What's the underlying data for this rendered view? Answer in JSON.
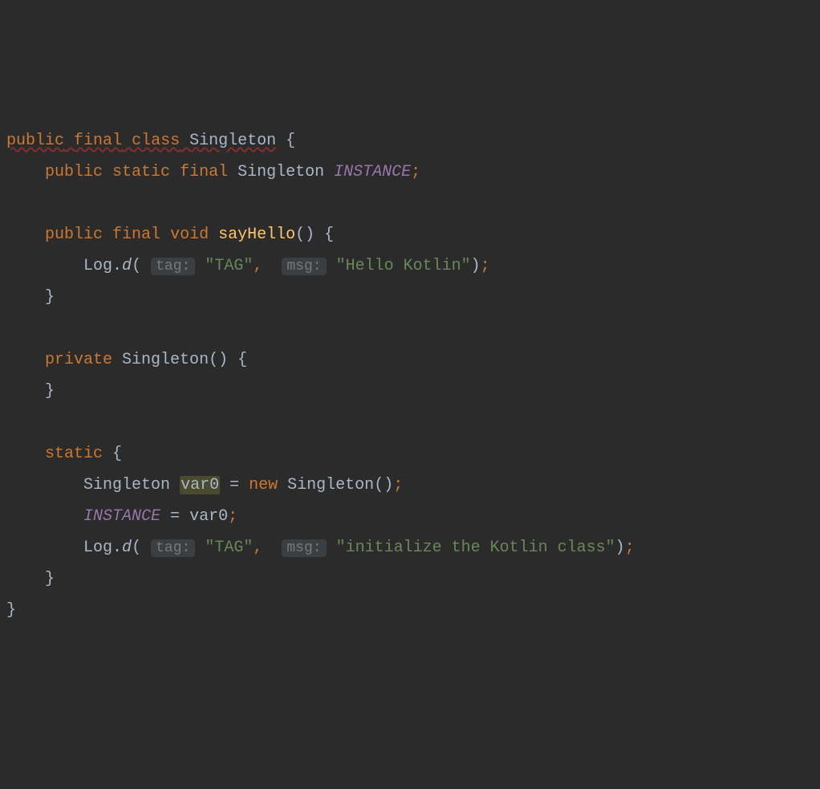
{
  "code": {
    "line1": {
      "kw_public": "public",
      "kw_final": "final",
      "kw_class": "class",
      "class_name": "Singleton",
      "brace_open": "{"
    },
    "line2": {
      "kw_public": "public",
      "kw_static": "static",
      "kw_final": "final",
      "type": "Singleton",
      "field": "INSTANCE",
      "semi": ";"
    },
    "line4": {
      "kw_public": "public",
      "kw_final": "final",
      "kw_void": "void",
      "method": "sayHello",
      "parens": "()",
      "brace_open": "{"
    },
    "line5": {
      "call_class": "Log",
      "dot": ".",
      "call_method": "d",
      "paren_open": "(",
      "hint_tag": "tag:",
      "str_tag": "\"TAG\"",
      "comma": ",",
      "hint_msg": "msg:",
      "str_msg": "\"Hello Kotlin\"",
      "paren_close": ")",
      "semi": ";"
    },
    "line6": {
      "brace_close": "}"
    },
    "line8": {
      "kw_private": "private",
      "ctor": "Singleton",
      "parens": "()",
      "brace_open": "{"
    },
    "line9": {
      "brace_close": "}"
    },
    "line11": {
      "kw_static": "static",
      "brace_open": "{"
    },
    "line12": {
      "type": "Singleton",
      "var": "var0",
      "eq": "=",
      "kw_new": "new",
      "ctor": "Singleton",
      "parens": "()",
      "semi": ";"
    },
    "line13": {
      "field": "INSTANCE",
      "eq": "=",
      "var": "var0",
      "semi": ";"
    },
    "line14": {
      "call_class": "Log",
      "dot": ".",
      "call_method": "d",
      "paren_open": "(",
      "hint_tag": "tag:",
      "str_tag": "\"TAG\"",
      "comma": ",",
      "hint_msg": "msg:",
      "str_msg": "\"initialize the Kotlin class\"",
      "paren_close": ")",
      "semi": ";"
    },
    "line15": {
      "brace_close": "}"
    },
    "line16": {
      "brace_close": "}"
    }
  }
}
